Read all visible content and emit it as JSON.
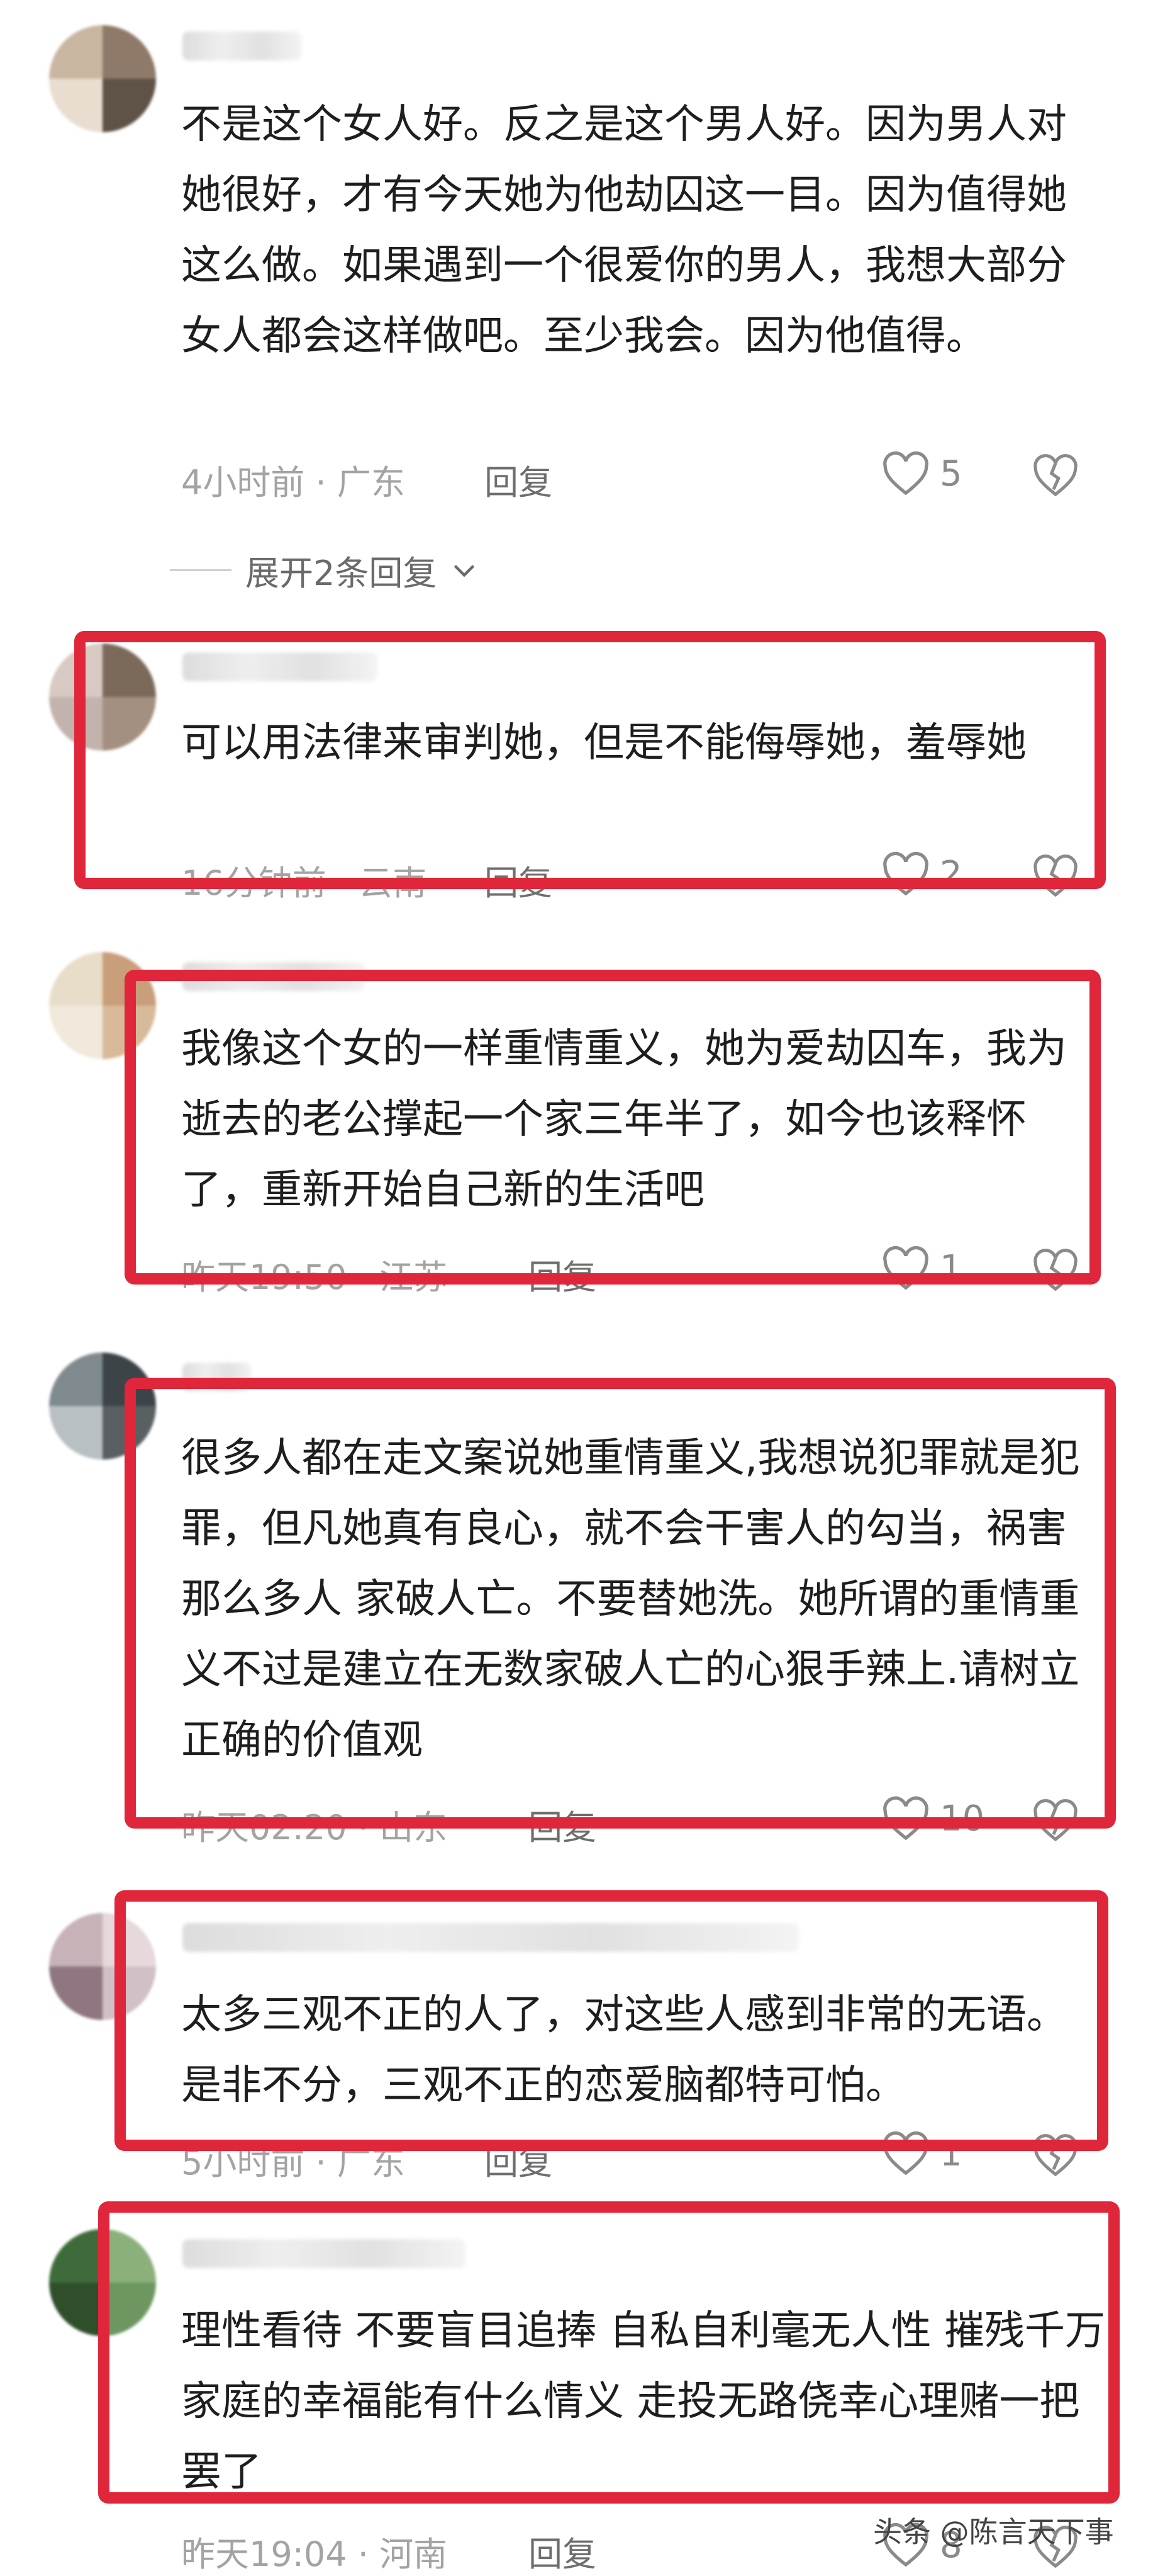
{
  "comments": [
    {
      "text": "不是这个女人好。反之是这个男人好。因为男人对她很好，才有今天她为他劫囚这一目。因为值得她这么做。如果遇到一个很爱你的男人，我想大部分女人都会这样做吧。至少我会。因为他值得。",
      "time_location": "4小时前 · 广东",
      "reply_label": "回复",
      "likes": "5",
      "expand_label": "展开2条回复",
      "avatar_colors": [
        "#c9b6a1",
        "#8f7a6a",
        "#e9ddd0",
        "#5f5348"
      ]
    },
    {
      "text": "可以用法律来审判她，但是不能侮辱她，羞辱她",
      "time_location": "16分钟前 · 云南",
      "reply_label": "回复",
      "likes": "2",
      "avatar_colors": [
        "#d8c9c2",
        "#7b6a5a",
        "#c2b3ad",
        "#a49080"
      ]
    },
    {
      "text": "我像这个女的一样重情重义，她为爱劫囚车，我为逝去的老公撑起一个家三年半了，如今也该释怀了，重新开始自己新的生活吧",
      "time_location": "昨天19:50 · 江苏",
      "reply_label": "回复",
      "likes": "1",
      "avatar_colors": [
        "#e8ddc9",
        "#c99e7a",
        "#f1e9dc",
        "#d8b999"
      ]
    },
    {
      "text": "很多人都在走文案说她重情重义,我想说犯罪就是犯罪，但凡她真有良心，就不会干害人的勾当，祸害那么多人 家破人亡。不要替她洗。她所谓的重情重义不过是建立在无数家破人亡的心狠手辣上.请树立正确的价值观",
      "time_location": "昨天02:20 · 山东",
      "reply_label": "回复",
      "likes": "10",
      "avatar_colors": [
        "#7f8a8f",
        "#3d4448",
        "#b8c0c4",
        "#5a5f62"
      ]
    },
    {
      "text": "太多三观不正的人了，对这些人感到非常的无语。是非不分，三观不正的恋爱脑都特可怕。",
      "time_location": "5小时前 · 广东",
      "reply_label": "回复",
      "likes": "1",
      "avatar_colors": [
        "#c7b2b8",
        "#e6d8db",
        "#8f7681",
        "#d1c0c6"
      ]
    },
    {
      "text": "理性看待 不要盲目追捧  自私自利毫无人性  摧残千万家庭的幸福能有什么情义  走投无路侥幸心理赌一把罢了",
      "time_location": "昨天19:04 · 河南",
      "reply_label": "回复",
      "likes": "8",
      "avatar_colors": [
        "#3f6b3a",
        "#8bb07c",
        "#2e4f2a",
        "#6e9661"
      ]
    }
  ],
  "watermark": "头条 @陈言天下事",
  "colors": {
    "highlight_box": "#e0263a",
    "meta_text": "#a3a3a3"
  },
  "icons": [
    "heart-outline-icon",
    "broken-heart-icon",
    "chevron-down-icon"
  ]
}
